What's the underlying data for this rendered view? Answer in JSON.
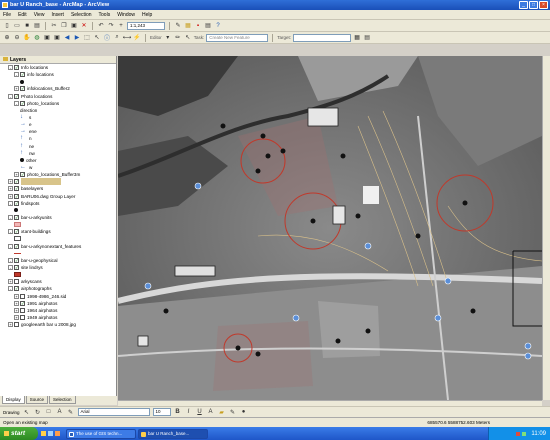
{
  "window": {
    "title": "bar U Ranch_base - ArcMap - ArcView"
  },
  "menu": [
    "File",
    "Edit",
    "View",
    "Insert",
    "Selection",
    "Tools",
    "Window",
    "Help"
  ],
  "toolbar1": {
    "scale": "1:1,243"
  },
  "toolbar2": {
    "editor_label": "Editor",
    "task_label": "Task:",
    "task_value": "Create New Feature",
    "target_label": "Target:"
  },
  "toc": {
    "header": "Layers",
    "rows": [
      {
        "text": "Info locations",
        "indent": 1,
        "pm": "-",
        "cb": true
      },
      {
        "text": "info locations",
        "indent": 2,
        "pm": "-",
        "cb": true
      },
      {
        "text": "",
        "indent": 3,
        "pm": "",
        "cb": null,
        "sym": "point"
      },
      {
        "text": "infolocations_Buffer2",
        "indent": 2,
        "pm": "+",
        "cb": true
      },
      {
        "text": "Photo locations",
        "indent": 1,
        "pm": "-",
        "cb": true
      },
      {
        "text": "photo_locations",
        "indent": 2,
        "pm": "-",
        "cb": true
      },
      {
        "text": "direction",
        "indent": 3,
        "pm": "",
        "cb": null
      },
      {
        "text": "s",
        "indent": 3,
        "pm": "",
        "cb": null,
        "sym": "arrow-down"
      },
      {
        "text": "e",
        "indent": 3,
        "pm": "",
        "cb": null,
        "sym": "arrow-right"
      },
      {
        "text": "ene",
        "indent": 3,
        "pm": "",
        "cb": null,
        "sym": "arrow-right"
      },
      {
        "text": "n",
        "indent": 3,
        "pm": "",
        "cb": null,
        "sym": "arrow-up"
      },
      {
        "text": "ne",
        "indent": 3,
        "pm": "",
        "cb": null,
        "sym": "arrow-up"
      },
      {
        "text": "nw",
        "indent": 3,
        "pm": "",
        "cb": null,
        "sym": "arrow-up"
      },
      {
        "text": "other",
        "indent": 3,
        "pm": "",
        "cb": null,
        "sym": "point"
      },
      {
        "text": "w",
        "indent": 3,
        "pm": "",
        "cb": null,
        "sym": "arrow-left"
      },
      {
        "text": "photo_locations_Buffer3m",
        "indent": 2,
        "pm": "+",
        "cb": true
      },
      {
        "text": "Boundaries Layer",
        "indent": 1,
        "pm": "+",
        "cb": true,
        "highlight": true
      },
      {
        "text": "baselayers",
        "indent": 1,
        "pm": "+",
        "cb": true
      },
      {
        "text": "BARU06.dwg Group Layer",
        "indent": 1,
        "pm": "+",
        "cb": true
      },
      {
        "text": "findspots",
        "indent": 1,
        "pm": "-",
        "cb": true
      },
      {
        "text": "",
        "indent": 2,
        "pm": "",
        "cb": null,
        "sym": "point"
      },
      {
        "text": "bar-u-arkyunits",
        "indent": 1,
        "pm": "-",
        "cb": true
      },
      {
        "text": "",
        "indent": 2,
        "pm": "",
        "cb": null,
        "sym": "fill-pink"
      },
      {
        "text": "xtant-buildings",
        "indent": 1,
        "pm": "-",
        "cb": true
      },
      {
        "text": "",
        "indent": 2,
        "pm": "",
        "cb": null,
        "sym": "fill-white"
      },
      {
        "text": "bar-u-arkynonextant_features",
        "indent": 1,
        "pm": "-",
        "cb": true
      },
      {
        "text": "",
        "indent": 2,
        "pm": "",
        "cb": null,
        "sym": "line-red"
      },
      {
        "text": "bar-u-geophysical",
        "indent": 1,
        "pm": "-",
        "cb": true
      },
      {
        "text": "site lindrys",
        "indent": 1,
        "pm": "-",
        "cb": true
      },
      {
        "text": "",
        "indent": 2,
        "pm": "",
        "cb": null,
        "sym": "fill-red"
      },
      {
        "text": "arkyscans",
        "indent": 1,
        "pm": "+",
        "cb": false
      },
      {
        "text": "airphotographs",
        "indent": 1,
        "pm": "-",
        "cb": true
      },
      {
        "text": "1998-4986_246.sid",
        "indent": 2,
        "pm": "+",
        "cb": false
      },
      {
        "text": "1991 airphotos",
        "indent": 2,
        "pm": "+",
        "cb": true
      },
      {
        "text": "1964 airphotos",
        "indent": 2,
        "pm": "+",
        "cb": false
      },
      {
        "text": "1949 airphotos",
        "indent": 2,
        "pm": "+",
        "cb": false
      },
      {
        "text": "googleearth bar u 2008.jpg",
        "indent": 1,
        "pm": "+",
        "cb": false
      }
    ]
  },
  "toc_tabs": [
    "Display",
    "Source",
    "Selection"
  ],
  "drawing": {
    "label": "Drawing",
    "font": "Arial",
    "size": "10",
    "bold": "B",
    "italic": "I",
    "underline": "U"
  },
  "status": {
    "message": "Open an existing map",
    "coords": "685570.6  5588752.603 Meters"
  },
  "taskbar": {
    "start": "start",
    "tasks": [
      "The use of GIS techn...",
      "bar U Ranch_base..."
    ],
    "clock": "11:09"
  }
}
